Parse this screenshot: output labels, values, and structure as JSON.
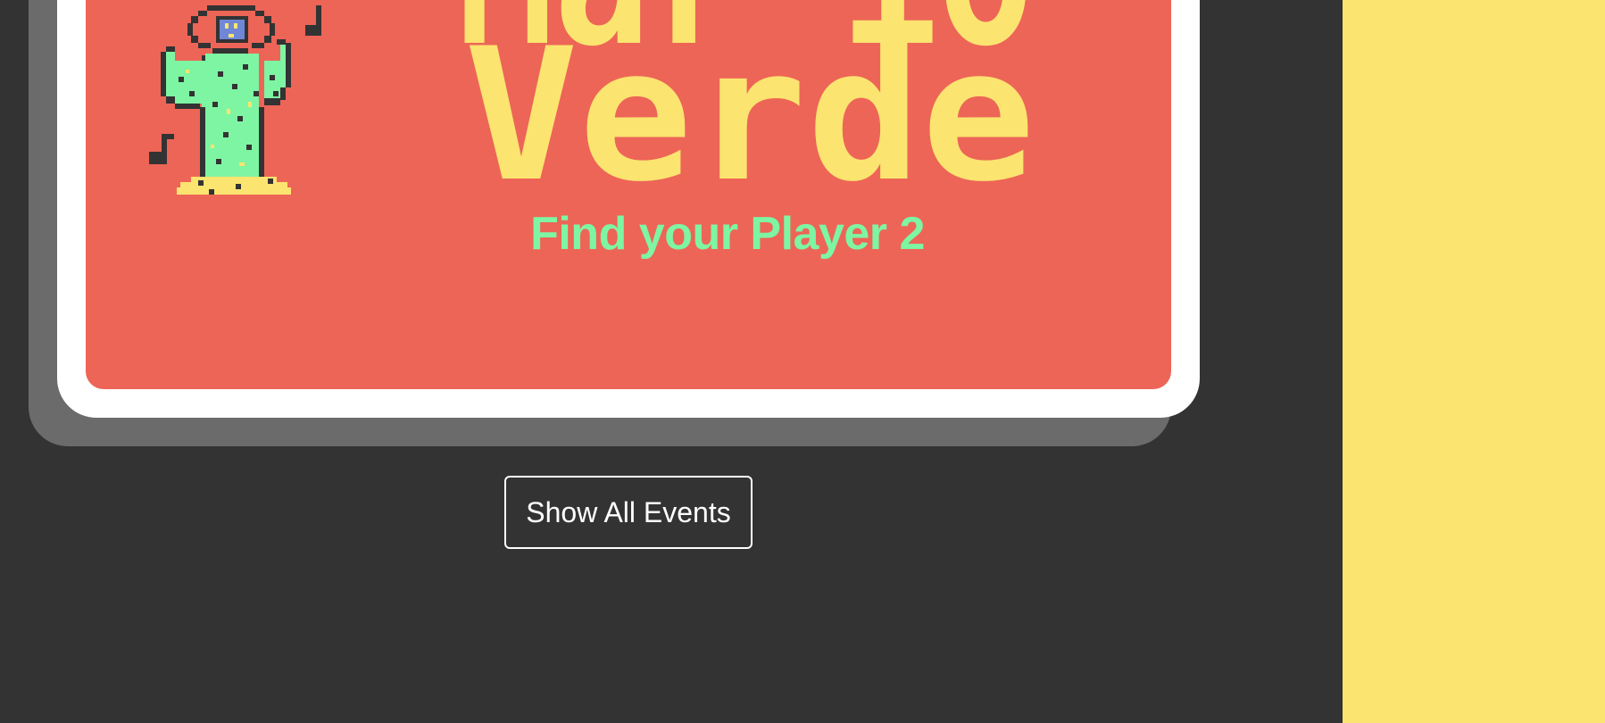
{
  "brand": {
    "title_line_1": "Mar io",
    "title_line_2": "Verde",
    "tagline": "Find your Player 2",
    "logo_icon": "cactus-mascot-icon",
    "note_icon": "music-note-icon"
  },
  "actions": {
    "show_all_events_label": "Show All Events"
  },
  "colors": {
    "background": "#333333",
    "card_frame": "#ffffff",
    "card_shadow": "#6b6b6b",
    "card_fill": "#ed6557",
    "title_yellow": "#fbe46f",
    "tagline_green": "#7ef5a2",
    "side_panel": "#fbe46f"
  }
}
